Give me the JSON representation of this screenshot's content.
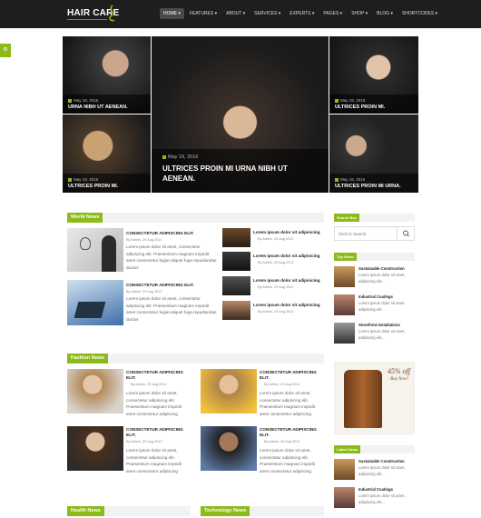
{
  "header": {
    "logo": "HAIR CARE",
    "nav": [
      "HOME ▾",
      "FEATURES ▾",
      "ABOUT ▾",
      "SERVICES ▾",
      "EXPERTS ▾",
      "PAGES ▾",
      "SHOP ▾",
      "BLOG ▾",
      "SHORTCODES ▾"
    ]
  },
  "side_tab": "⚙",
  "hero": {
    "tiles": [
      {
        "date": "May 19, 2016",
        "title": "URNA NIBH UT AENEAN."
      },
      {
        "date": "May 19, 2016",
        "title": "ULTRICES PROIN MI URNA NIBH UT AENEAN."
      },
      {
        "date": "May 19, 2016",
        "title": "ULTRICES PROIN MI."
      },
      {
        "date": "May 19, 2016",
        "title": "ULTRICES PROIN MI."
      },
      {
        "date": "May 19, 2016",
        "title": "ULTRICES PROIN MI URNA."
      }
    ]
  },
  "world_news": {
    "label": "World News",
    "featured": [
      {
        "title": "CONSECTETUR ADIPISCING ELIT.",
        "meta": "By Admin, 29 Aug 2012",
        "body": "Lorem ipsum dolor sit amet, consectetur adipiscing elit. Praesentium magnam impedit amet consectetur fugiat aliquet fuga repudiandae ductus"
      },
      {
        "title": "CONSECTETUR ADIPISCING ELIT.",
        "meta": "By Admin, 29 Aug 2012",
        "body": "Lorem ipsum dolor sit amet, consectetur adipiscing elit. Praesentium magnam impedit amet consectetur fugiat aliquet fuga repudiandae ductus"
      }
    ],
    "small": [
      {
        "title": "Lorem ipsum dolor sit adipisicing",
        "meta": "By Admin, 29 Aug 2012"
      },
      {
        "title": "Lorem ipsum dolor sit adipisicing",
        "meta": "By Admin, 29 Aug 2012"
      },
      {
        "title": "Lorem ipsum dolor sit adipisicing",
        "meta": "By Admin, 29 Aug 2012"
      },
      {
        "title": "Lorem ipsum dolor sit adipisicing",
        "meta": "By Admin, 29 Aug 2012"
      }
    ]
  },
  "fashion_news": {
    "label": "Fashion News",
    "posts": [
      {
        "title": "CONSECTETUR ADIPISCING ELIT.",
        "meta": "By Admin, 29 Aug 2012",
        "body": "Lorem ipsum dolor sit amet, consectetur adipiscing elit. Praesentium magnam impedit amet consectetur adipiscing"
      },
      {
        "title": "CONSECTETUR ADIPISCING ELIT.",
        "meta": "By Admin, 29 Aug 2012",
        "body": "Lorem ipsum dolor sit amet, consectetur adipiscing elit. Praesentium magnam impedit amet consectetur adipiscing"
      },
      {
        "title": "CONSECTETUR ADIPISCING ELIT.",
        "meta": "By Admin, 29 Aug 2012",
        "body": "Lorem ipsum dolor sit amet, consectetur adipiscing elit. Praesentium magnam impedit amet consectetur adipiscing"
      },
      {
        "title": "CONSECTETUR ADIPISCING ELIT.",
        "meta": "By Admin, 29 Aug 2012",
        "body": "Lorem ipsum dolor sit amet, consectetur adipiscing elit. Praesentium magnam impedit amet consectetur adipiscing"
      }
    ]
  },
  "bottom_sections": {
    "health": "Health News",
    "technology": "Technology News"
  },
  "sidebar": {
    "search_label": "Search Box",
    "search_placeholder": "Click to Search",
    "top_news_label": "Top News",
    "top_news": [
      {
        "title": "Sustainable Construction",
        "body": "Lorem ipsum dolor sit amet, adipiscing elit..."
      },
      {
        "title": "Industrial Coatings",
        "body": "Lorem ipsum dolor sit amet, adipiscing elit..."
      },
      {
        "title": "Storefront Installations",
        "body": "Lorem ipsum dolor sit amet, adipiscing elit..."
      }
    ],
    "ad": {
      "headline": "45% off",
      "sub": "Buy Now!"
    },
    "latest_news_label": "Latest News",
    "latest_news": [
      {
        "title": "Sustainable Construction",
        "body": "Lorem ipsum dolor sit amet, adipiscing elit..."
      },
      {
        "title": "Industrial Coatings",
        "body": "Lorem ipsum dolor sit amet, adipiscing elit..."
      }
    ]
  },
  "colors": {
    "accent": "#8cba1a",
    "header_bg": "#1e1e1e"
  }
}
